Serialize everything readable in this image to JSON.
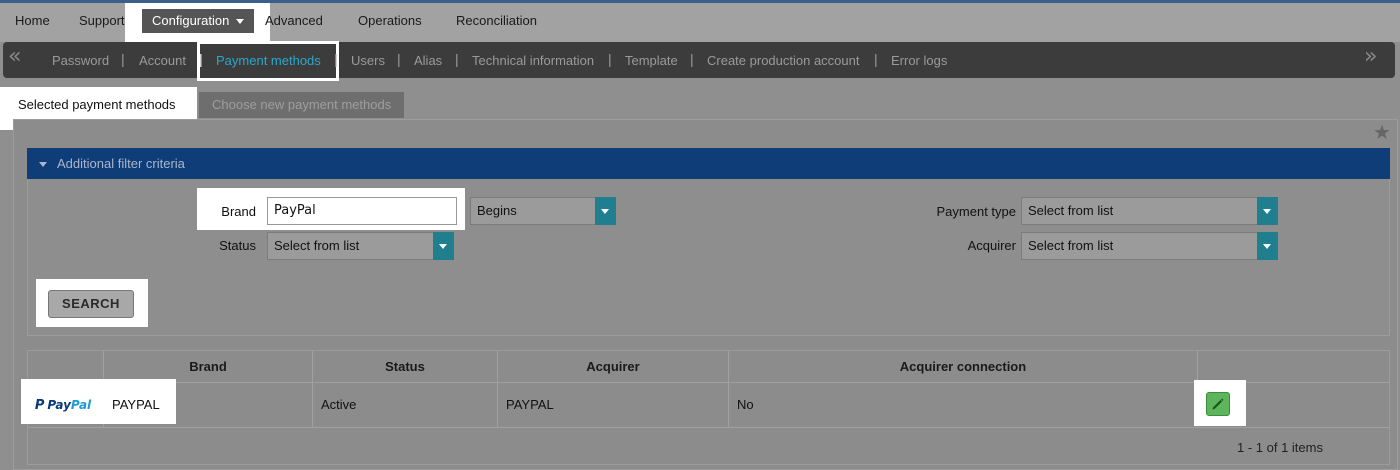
{
  "top_menu": {
    "items": [
      "Home",
      "Support",
      "Configuration",
      "Advanced",
      "Operations",
      "Reconciliation"
    ]
  },
  "sub_nav": {
    "items": [
      "Password",
      "Account",
      "Payment methods",
      "Users",
      "Alias",
      "Technical information",
      "Template",
      "Create production account",
      "Error logs"
    ]
  },
  "tabs": [
    "Selected payment methods",
    "Choose new payment methods"
  ],
  "filter": {
    "header": "Additional filter criteria",
    "brand_label": "Brand",
    "brand_value": "PayPal",
    "match_value": "Begins",
    "status_label": "Status",
    "status_value": "Select from list",
    "payment_type_label": "Payment type",
    "payment_type_value": "Select from list",
    "acquirer_label": "Acquirer",
    "acquirer_value": "Select from list",
    "search_label": "SEARCH"
  },
  "table": {
    "headers": [
      "Brand",
      "Status",
      "Acquirer",
      "Acquirer connection"
    ],
    "row": {
      "logo_text_a": "Pay",
      "logo_text_b": "Pal",
      "brand": "PAYPAL",
      "status": "Active",
      "acquirer": "PAYPAL",
      "connection": "No"
    },
    "pager": "1 - 1 of 1 items"
  },
  "colors": {
    "accent": "#2aa7c9",
    "filter_header": "#0e3d78",
    "edit_button": "#5cb55a"
  },
  "icons": [
    "caret-down-icon",
    "double-chevron-left-icon",
    "double-chevron-right-icon",
    "star-icon",
    "pencil-icon",
    "paypal-logo"
  ]
}
